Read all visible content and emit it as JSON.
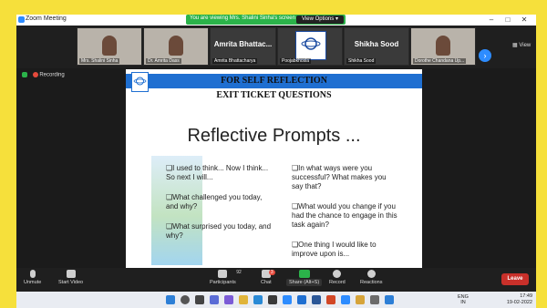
{
  "window": {
    "title": "Zoom Meeting"
  },
  "banner": {
    "text": "You are viewing Mrs. Shalini Sinha's screen",
    "view_options": "View Options ▾"
  },
  "window_buttons": {
    "minimize": "–",
    "maximize": "□",
    "close": "✕"
  },
  "gallery": {
    "tiles": [
      {
        "label": "Mrs. Shalini Sinha"
      },
      {
        "label": "Dr. Amrita Dass"
      },
      {
        "big_name": "Amrita  Bhattac...",
        "label": "Amrita Bhattacharya"
      },
      {
        "label": "Poojabkhosla"
      },
      {
        "big_name": "Shikha Sood",
        "label": "Shikha Sood"
      },
      {
        "label": "Dorothe Chandana Up..."
      }
    ],
    "view_label": "View"
  },
  "recording": {
    "label": "Recording"
  },
  "slide": {
    "header1": "FOR SELF REFLECTION",
    "header2": "EXIT TICKET QUESTIONS",
    "title": "Reflective Prompts ...",
    "left_items": [
      "❑I used to think... Now I think... So next I will...",
      "❑What challenged you today, and why?",
      "❑What surprised you today, and why?"
    ],
    "right_items": [
      "❑In what ways were you successful? What makes you say that?",
      "❑What would you change if you had the chance to engage in this task again?",
      "❑One thing I would like to improve upon is..."
    ]
  },
  "controls": {
    "unmute": "Unmute",
    "start_video": "Start Video",
    "participants": "Participants",
    "participants_count": "92",
    "chat": "Chat",
    "chat_badge": "3",
    "share": "Share (Alt+S)",
    "record": "Record",
    "reactions": "Reactions",
    "leave": "Leave"
  },
  "taskbar": {
    "lang_top": "ENG",
    "lang_bottom": "IN",
    "time": "17:49",
    "date": "19-02-2022"
  },
  "colors": {
    "accent": "#2d8cff",
    "leave": "#c8302a",
    "share": "#2bb34a",
    "frame": "#f6e03b"
  }
}
